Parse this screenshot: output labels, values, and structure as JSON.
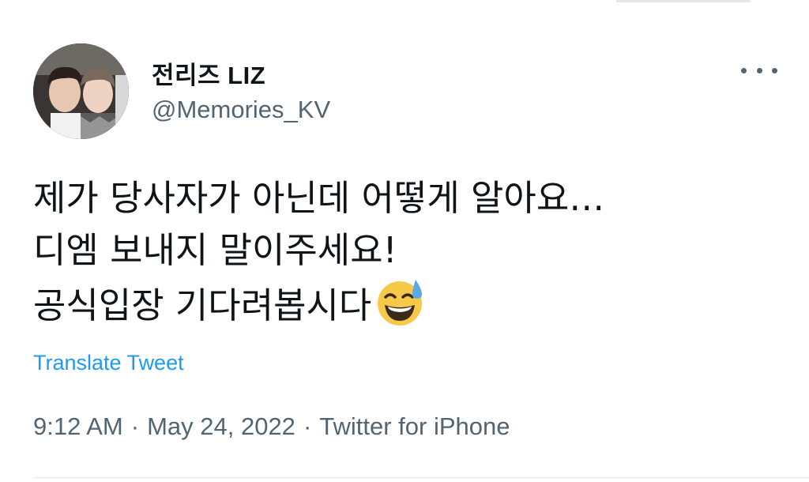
{
  "tweet": {
    "author": {
      "display_name": "전리즈 LIZ",
      "handle": "@Memories_KV"
    },
    "text_lines": [
      "제가 당사자가 아닌데 어떻게 알아요…",
      "디엠 보내지 말이주세요!",
      "공식입장 기다려봅시다"
    ],
    "emoji": "grinning-face-with-sweat-icon",
    "translate_label": "Translate Tweet",
    "time": "9:12 AM",
    "separator": "·",
    "date": "May 24, 2022",
    "source": "Twitter for iPhone"
  },
  "colors": {
    "text_primary": "#0f1419",
    "text_secondary": "#536471",
    "link": "#1d9bf0",
    "emoji_face": "#f7c948",
    "emoji_sweat": "#5aa9e6"
  }
}
